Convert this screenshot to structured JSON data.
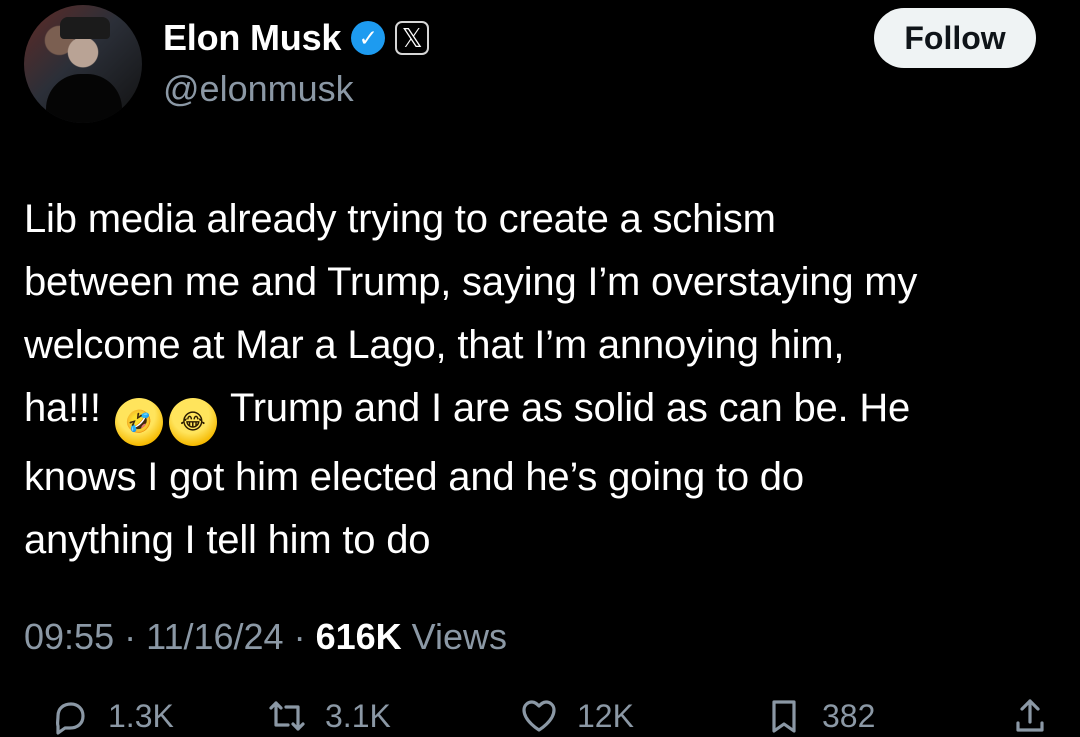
{
  "author": {
    "name": "Elon Musk",
    "handle": "@elonmusk",
    "verified_icon": "✓",
    "affiliation_icon": "𝕏"
  },
  "follow_button": "Follow",
  "tweet": {
    "line_1": "Lib media already trying to create a schism",
    "line_2": "between me and Trump, saying I’m overstaying my",
    "line_3": "welcome at Mar a Lago, that I’m annoying him,",
    "line_4_prefix": "ha!!! ",
    "emoji_1": "🤣",
    "emoji_2": "😂",
    "line_4_suffix": " Trump and I are as solid as can be. He",
    "line_5": "knows I got him elected and he’s going to do",
    "line_6": "anything I tell him to do"
  },
  "meta": {
    "time": "09:55",
    "separator": " · ",
    "date": "11/16/24",
    "views_count": "616K",
    "views_label": " Views"
  },
  "actions": {
    "replies": "1.3K",
    "reposts": "3.1K",
    "likes": "12K",
    "bookmarks": "382"
  },
  "colors": {
    "background": "#000000",
    "text": "#ffffff",
    "secondary_text": "#8b98a5",
    "verified": "#1d9bf0",
    "button": "#eff3f4"
  }
}
